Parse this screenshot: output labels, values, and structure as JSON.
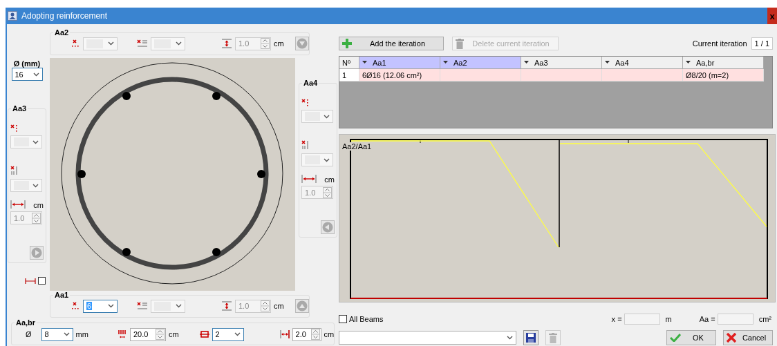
{
  "window": {
    "title": "Adopting reinforcement",
    "close": "x"
  },
  "diameter": {
    "label": "Ø (mm)",
    "value": "16"
  },
  "aa2": {
    "title": "Aa2",
    "count": {
      "disabled": true
    },
    "spacing": {
      "disabled": true
    },
    "cover": {
      "value": "1.0",
      "unit": "cm",
      "disabled": true
    }
  },
  "aa3": {
    "title": "Aa3",
    "count": {
      "disabled": true
    },
    "spacing": {
      "disabled": true
    },
    "cover": {
      "value": "1.0",
      "unit": "cm",
      "disabled": true
    }
  },
  "aa4": {
    "title": "Aa4",
    "count": {
      "disabled": true
    },
    "spacing": {
      "disabled": true
    },
    "cover": {
      "value": "1.0",
      "unit": "cm",
      "disabled": true
    }
  },
  "aa1": {
    "title": "Aa1",
    "count": {
      "value": "6",
      "disabled": false,
      "selected": true
    },
    "spacing": {
      "disabled": true
    },
    "cover": {
      "value": "1.0",
      "unit": "cm",
      "disabled": true
    }
  },
  "show_spacing": {
    "checked": false
  },
  "aa_br": {
    "title": "Aa,br",
    "diameter": {
      "label": "Ø",
      "value": "8",
      "unit": "mm"
    },
    "spacing": {
      "value": "20.0",
      "unit": "cm"
    },
    "legs": {
      "value": "2"
    },
    "cover": {
      "value": "2.0",
      "unit": "cm"
    }
  },
  "toolbar": {
    "add": {
      "label": "Add the iteration",
      "disabled": false
    },
    "delete": {
      "label": "Delete current iteration",
      "disabled": true
    },
    "current": {
      "label": "Current iteration",
      "value": "1 / 1"
    }
  },
  "table": {
    "columns": [
      {
        "label": "Nº",
        "selected": false
      },
      {
        "label": "Aa1",
        "selected": true
      },
      {
        "label": "Aa2",
        "selected": true
      },
      {
        "label": "Aa3",
        "selected": false
      },
      {
        "label": "Aa4",
        "selected": false
      },
      {
        "label": "Aa,br",
        "selected": false
      }
    ],
    "rows": [
      {
        "no": "1",
        "aa1": "6Ø16 (12.06 cm²)",
        "aa_br": "Ø8/20 (m=2)"
      }
    ]
  },
  "diagram": {
    "label": "Aa2/Aa1"
  },
  "all_beams": {
    "label": "All Beams",
    "checked": false
  },
  "x_field": {
    "label": "x =",
    "unit": "m"
  },
  "aa_field": {
    "label": "Aa =",
    "unit": "cm²"
  },
  "buttons": [
    {
      "label": "OK",
      "kind": "ok"
    },
    {
      "label": "Cancel",
      "kind": "cancel"
    }
  ]
}
